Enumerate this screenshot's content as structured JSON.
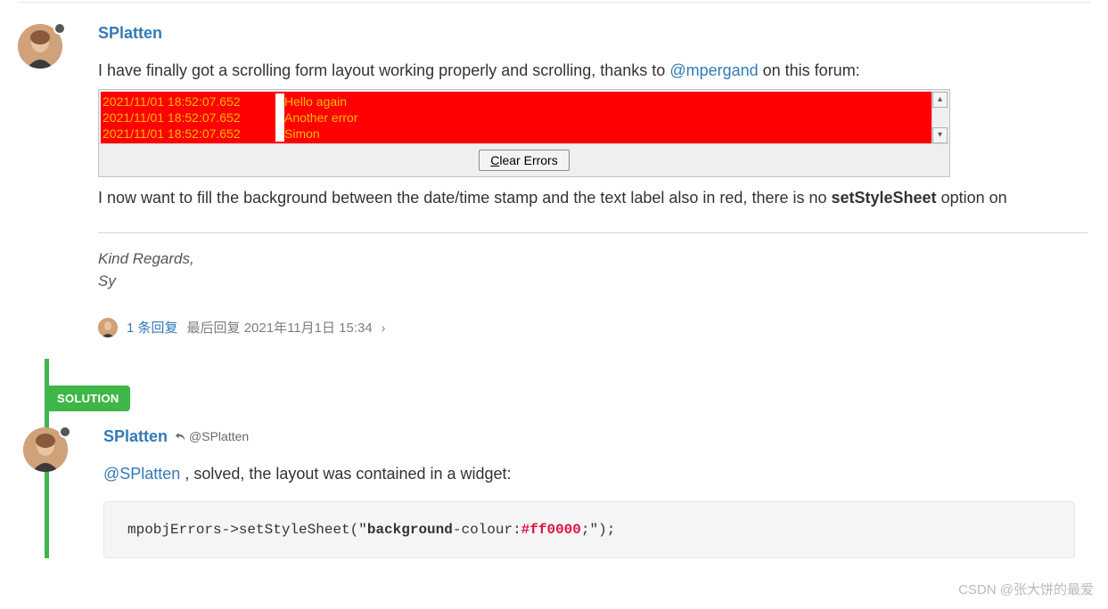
{
  "post1": {
    "author": "SPlatten",
    "text_before_mention": "I have finally got a scrolling form layout working properly and scrolling, thanks to ",
    "mention": "@mpergand",
    "text_after_mention": " on this forum:",
    "errors": [
      {
        "timestamp": "2021/11/01 18:52:07.652",
        "message": "Hello again"
      },
      {
        "timestamp": "2021/11/01 18:52:07.652",
        "message": "Another error"
      },
      {
        "timestamp": "2021/11/01 18:52:07.652",
        "message": "Simon"
      }
    ],
    "clear_button_prefix": "C",
    "clear_button_rest": "lear Errors",
    "text2_before_bold": "I now want to fill the background between the date/time stamp and the text label also in red, there is no ",
    "bold_method": "setStyleSheet",
    "text2_after_bold": " option on",
    "sig_line1": "Kind Regards,",
    "sig_line2": "Sy",
    "reply_count": "1 条回复",
    "reply_label": "最后回复",
    "reply_time": "2021年11月1日 15:34",
    "chevron": "›"
  },
  "solution_label": "SOLUTION",
  "post2": {
    "author": "SPlatten",
    "reply_to": "@SPlatten",
    "mention": "@SPlatten",
    "text_after": " , solved, the layout was contained in a widget:",
    "code_prefix": "mpobjErrors->setStyleSheet(\"",
    "code_keyword": "background",
    "code_mid": "-colour:",
    "code_hex": "#ff0000",
    "code_suffix": ";\");"
  },
  "watermark": "CSDN @张大饼的最爱"
}
